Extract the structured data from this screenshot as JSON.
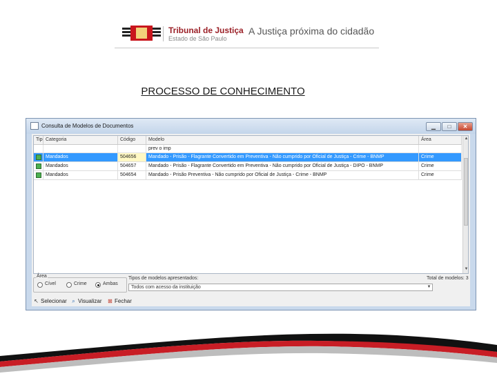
{
  "header": {
    "logo_title": "Tribunal de Justiça",
    "logo_subtitle": "Estado de São Paulo",
    "tagline": "A Justiça próxima do cidadão"
  },
  "page_title": "PROCESSO DE CONHECIMENTO",
  "window": {
    "title": "Consulta de Modelos de Documentos",
    "minimize": "▁",
    "maximize": "□",
    "close": "✕"
  },
  "grid": {
    "columns": {
      "tipo": "Tipo",
      "categoria": "Categoria",
      "codigo": "Código",
      "modelo": "Modelo",
      "area": "Área"
    },
    "filter_value": "prev o imp",
    "rows": [
      {
        "categoria": "Mandados",
        "codigo": "504656",
        "modelo": "Mandado - Prisão - Flagrante Convertido em Preventiva - Não cumprido por Oficial de Justiça - Crime - BNMP",
        "area": "Crime",
        "selected": true
      },
      {
        "categoria": "Mandados",
        "codigo": "504657",
        "modelo": "Mandado - Prisão - Flagrante Convertido em Preventiva - Não cumprido por Oficial de Justiça - DIPO - BNMP",
        "area": "Crime",
        "selected": false
      },
      {
        "categoria": "Mandados",
        "codigo": "504654",
        "modelo": "Mandado - Prisão Preventiva - Não cumprido por Oficial de Justiça - Crime - BNMP",
        "area": "Crime",
        "selected": false
      }
    ]
  },
  "footer_panel": {
    "area_legend": "Área",
    "radio_civel": "Cível",
    "radio_crime": "Crime",
    "radio_ambas": "Ambas",
    "selected_area": "Ambas",
    "tipos_label": "Tipos de modelos apresentados:",
    "tipos_value": "Todos com acesso da instituição",
    "total_label": "Total de modelos: 3"
  },
  "toolbar": {
    "selecionar": "Selecionar",
    "visualizar": "Visualizar",
    "fechar": "Fechar"
  },
  "colors": {
    "brand_red": "#9b2027",
    "selection_blue": "#3399ff",
    "window_frame": "#c9d9ec"
  }
}
